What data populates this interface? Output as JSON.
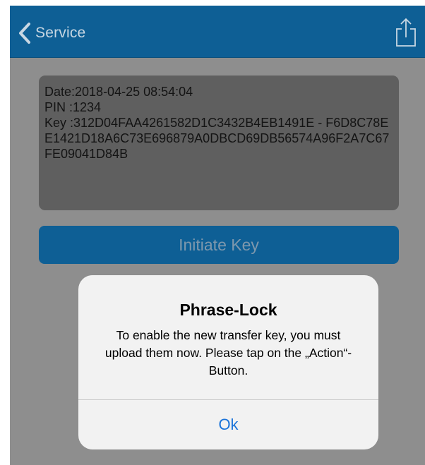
{
  "navbar": {
    "back_label": "Service",
    "share_icon": "share-icon",
    "back_icon": "chevron-left-icon",
    "color": "#0e5f95"
  },
  "info": {
    "date_line": "Date:2018-04-25 08:54:04",
    "pin_line": "PIN :1234",
    "key_line": "Key :312D04FAA4261582D1C3432B4EB1491E - F6D8C78EE1421D18A6C73E696879A0DBCD69DB56574A96F2A7C67FE09041D84B"
  },
  "initiate_button": {
    "label": "Initiate Key"
  },
  "alert": {
    "title": "Phrase-Lock",
    "message": "To enable the new transfer key, you must upload them now. Please tap on the „Action“-Button.",
    "ok_label": "Ok"
  }
}
